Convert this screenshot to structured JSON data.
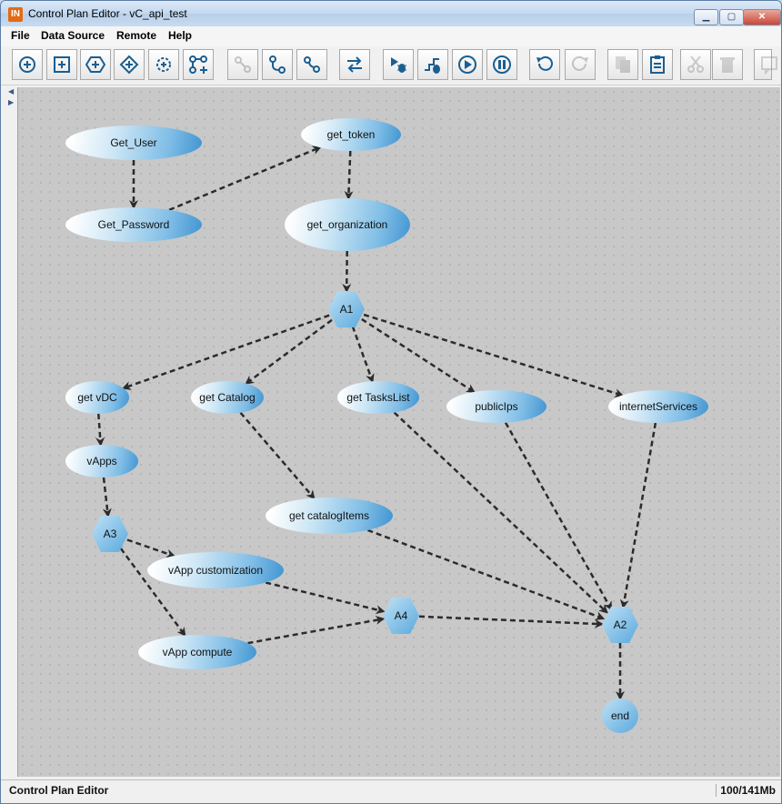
{
  "window": {
    "title": "Control Plan Editor - vC_api_test",
    "app_icon_text": "IN",
    "minimize": "▁",
    "maximize": "▢",
    "close": "✕"
  },
  "menu": [
    "File",
    "Data Source",
    "Remote",
    "Help"
  ],
  "toolbar": [
    {
      "name": "add-start-node-button",
      "icon": "plus-circle-icon",
      "enabled": true
    },
    {
      "name": "add-task-node-button",
      "icon": "plus-square-icon",
      "enabled": true
    },
    {
      "name": "add-hexagon-node-button",
      "icon": "plus-hexagon-icon",
      "enabled": true
    },
    {
      "name": "add-diamond-node-button",
      "icon": "plus-diamond-icon",
      "enabled": true
    },
    {
      "name": "add-gear-node-button",
      "icon": "plus-gear-icon",
      "enabled": true
    },
    {
      "name": "add-branch-button",
      "icon": "branch-add-icon",
      "enabled": true
    },
    {
      "name": "connect-button",
      "icon": "link-icon",
      "enabled": false
    },
    {
      "name": "connect-nodes-button",
      "icon": "connect-nodes-icon",
      "enabled": true
    },
    {
      "name": "disconnect-nodes-button",
      "icon": "disconnect-nodes-icon",
      "enabled": true
    },
    {
      "name": "swap-direction-button",
      "icon": "swap-arrows-icon",
      "enabled": true
    },
    {
      "name": "debug-run-button",
      "icon": "debug-run-icon",
      "enabled": true
    },
    {
      "name": "debug-step-button",
      "icon": "debug-step-icon",
      "enabled": true
    },
    {
      "name": "play-button",
      "icon": "play-icon",
      "enabled": true
    },
    {
      "name": "pause-button",
      "icon": "pause-icon",
      "enabled": true
    },
    {
      "name": "undo-button",
      "icon": "undo-icon",
      "enabled": true
    },
    {
      "name": "redo-button",
      "icon": "redo-icon",
      "enabled": false
    },
    {
      "name": "copy-button",
      "icon": "copy-icon",
      "enabled": false
    },
    {
      "name": "paste-button",
      "icon": "clipboard-icon",
      "enabled": true
    },
    {
      "name": "cut-button",
      "icon": "scissors-icon",
      "enabled": false
    },
    {
      "name": "delete-button",
      "icon": "trash-icon",
      "enabled": false
    },
    {
      "name": "comment-button",
      "icon": "comment-icon",
      "enabled": false
    }
  ],
  "nodes": [
    {
      "id": "get_user",
      "label": "Get_User"
    },
    {
      "id": "get_password",
      "label": "Get_Password"
    },
    {
      "id": "get_token",
      "label": "get_token"
    },
    {
      "id": "get_organization",
      "label": "get_organization"
    },
    {
      "id": "a1",
      "label": "A1"
    },
    {
      "id": "get_vdc",
      "label": "get vDC"
    },
    {
      "id": "get_catalog",
      "label": "get Catalog"
    },
    {
      "id": "get_taskslist",
      "label": "get TasksList"
    },
    {
      "id": "publicips",
      "label": "publicIps"
    },
    {
      "id": "internetservices",
      "label": "internetServices"
    },
    {
      "id": "vapps",
      "label": "vApps"
    },
    {
      "id": "get_catalogitems",
      "label": "get catalogItems"
    },
    {
      "id": "a3",
      "label": "A3"
    },
    {
      "id": "vapp_customization",
      "label": "vApp customization"
    },
    {
      "id": "a4",
      "label": "A4"
    },
    {
      "id": "a2",
      "label": "A2"
    },
    {
      "id": "vapp_compute",
      "label": "vApp compute"
    },
    {
      "id": "end",
      "label": "end"
    }
  ],
  "edges": [
    [
      "get_user",
      "get_password"
    ],
    [
      "get_password",
      "get_token"
    ],
    [
      "get_token",
      "get_organization"
    ],
    [
      "get_organization",
      "a1"
    ],
    [
      "a1",
      "get_vdc"
    ],
    [
      "a1",
      "get_catalog"
    ],
    [
      "a1",
      "get_taskslist"
    ],
    [
      "a1",
      "publicips"
    ],
    [
      "a1",
      "internetservices"
    ],
    [
      "get_vdc",
      "vapps"
    ],
    [
      "vapps",
      "a3"
    ],
    [
      "get_catalog",
      "get_catalogitems"
    ],
    [
      "a3",
      "vapp_customization"
    ],
    [
      "a3",
      "vapp_compute"
    ],
    [
      "vapp_customization",
      "a4"
    ],
    [
      "vapp_compute",
      "a4"
    ],
    [
      "a4",
      "a2"
    ],
    [
      "get_catalogitems",
      "a2"
    ],
    [
      "get_taskslist",
      "a2"
    ],
    [
      "publicips",
      "a2"
    ],
    [
      "internetservices",
      "a2"
    ],
    [
      "a2",
      "end"
    ]
  ],
  "status": {
    "left": "Control Plan Editor",
    "memory": "100/141Mb"
  },
  "colors": {
    "edge": "#2b2b2b",
    "node_accent": "#3f93d0"
  }
}
